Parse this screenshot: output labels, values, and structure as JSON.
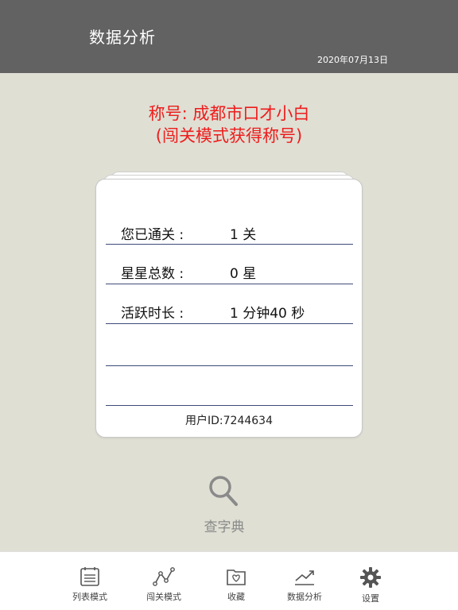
{
  "header": {
    "title": "数据分析",
    "date": "2020年07月13日"
  },
  "main": {
    "title_line1": "称号: 成都市口才小白",
    "title_line2": "(闯关模式获得称号)",
    "stats": [
      {
        "label": "您已通关 :",
        "value": "1 关"
      },
      {
        "label": "星星总数 :",
        "value": "0 星"
      },
      {
        "label": "活跃时长 :",
        "value": "1 分钟40 秒"
      }
    ],
    "user_id": "用户ID:7244634",
    "dictionary_label": "查字典"
  },
  "tabbar": {
    "items": [
      {
        "label": "列表模式",
        "icon": "list-calendar-icon"
      },
      {
        "label": "闯关模式",
        "icon": "path-nodes-icon"
      },
      {
        "label": "收藏",
        "icon": "heart-folder-icon"
      },
      {
        "label": "数据分析",
        "icon": "trend-line-icon"
      },
      {
        "label": "设置",
        "icon": "gear-icon"
      }
    ]
  },
  "colors": {
    "header_bg": "#626262",
    "page_bg": "#dfdfd4",
    "title_red": "#ee1c1c",
    "divider": "#3f4a78"
  }
}
